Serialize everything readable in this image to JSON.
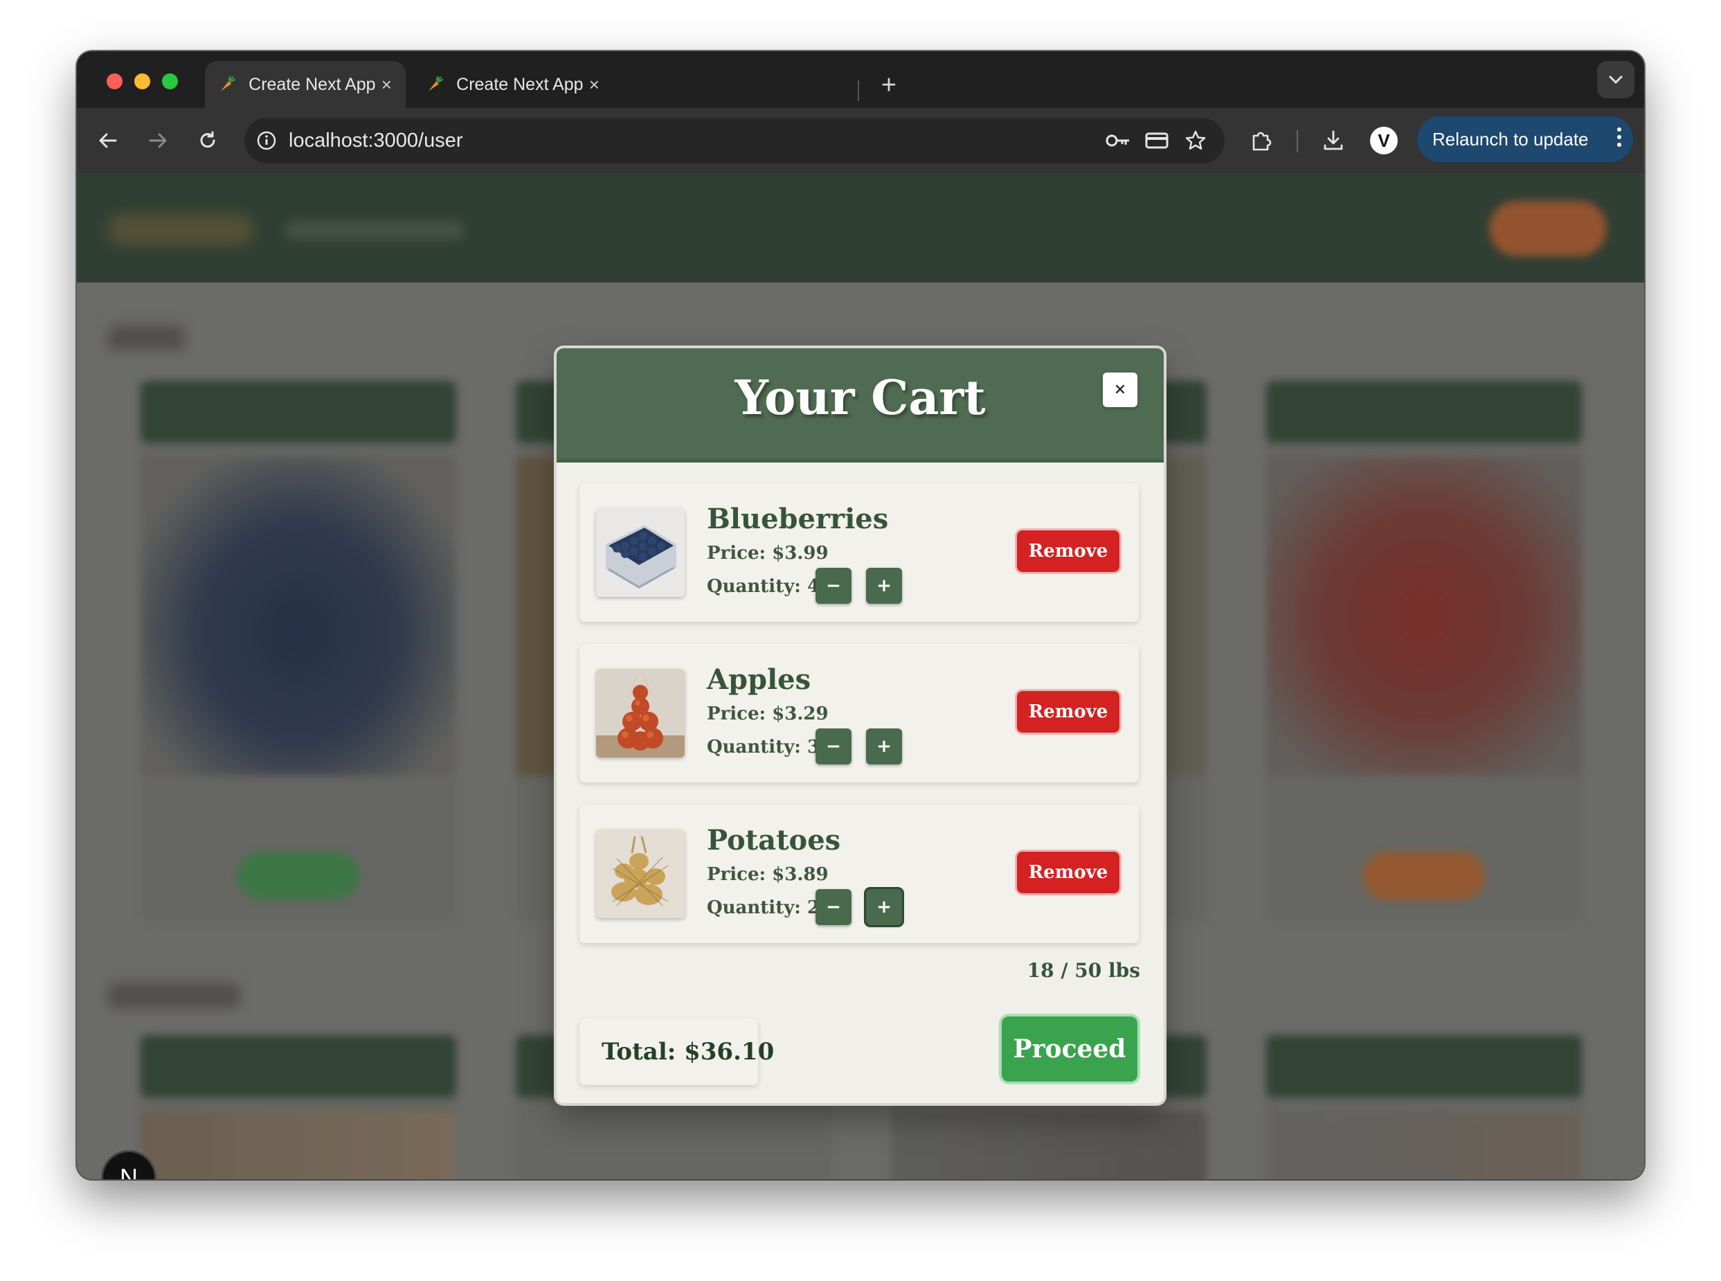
{
  "browser": {
    "tabs": [
      {
        "title": "Create Next App",
        "active": true
      },
      {
        "title": "Create Next App",
        "active": false
      }
    ],
    "tab_close_glyph": "×",
    "new_tab_glyph": "+",
    "url": "localhost:3000/user",
    "relaunch_label": "Relaunch to update",
    "profile_initial": "V",
    "icons": [
      "back-icon",
      "forward-icon",
      "reload-icon",
      "site-info-icon",
      "key-icon",
      "card-icon",
      "star-icon",
      "extensions-icon",
      "download-icon",
      "tab-search-icon",
      "more-icon"
    ]
  },
  "cart": {
    "title": "Your Cart",
    "close_glyph": "×",
    "items": [
      {
        "name": "Blueberries",
        "price": "Price: $3.99",
        "quantity": "Quantity: 4",
        "remove_label": "Remove",
        "minus": "−",
        "plus": "+"
      },
      {
        "name": "Apples",
        "price": "Price: $3.29",
        "quantity": "Quantity: 3",
        "remove_label": "Remove",
        "minus": "−",
        "plus": "+"
      },
      {
        "name": "Potatoes",
        "price": "Price: $3.89",
        "quantity": "Quantity: 2",
        "remove_label": "Remove",
        "minus": "−",
        "plus": "+"
      }
    ],
    "weight": "18 / 50 lbs",
    "total": "Total: $36.10",
    "proceed_label": "Proceed"
  },
  "colors": {
    "modal_header": "#4f6b51",
    "remove_button": "#d42121",
    "proceed_button": "#3aa34e",
    "qty_button": "#4a6a4e",
    "relaunch_button": "#1d4870"
  },
  "dev_badge": "N"
}
